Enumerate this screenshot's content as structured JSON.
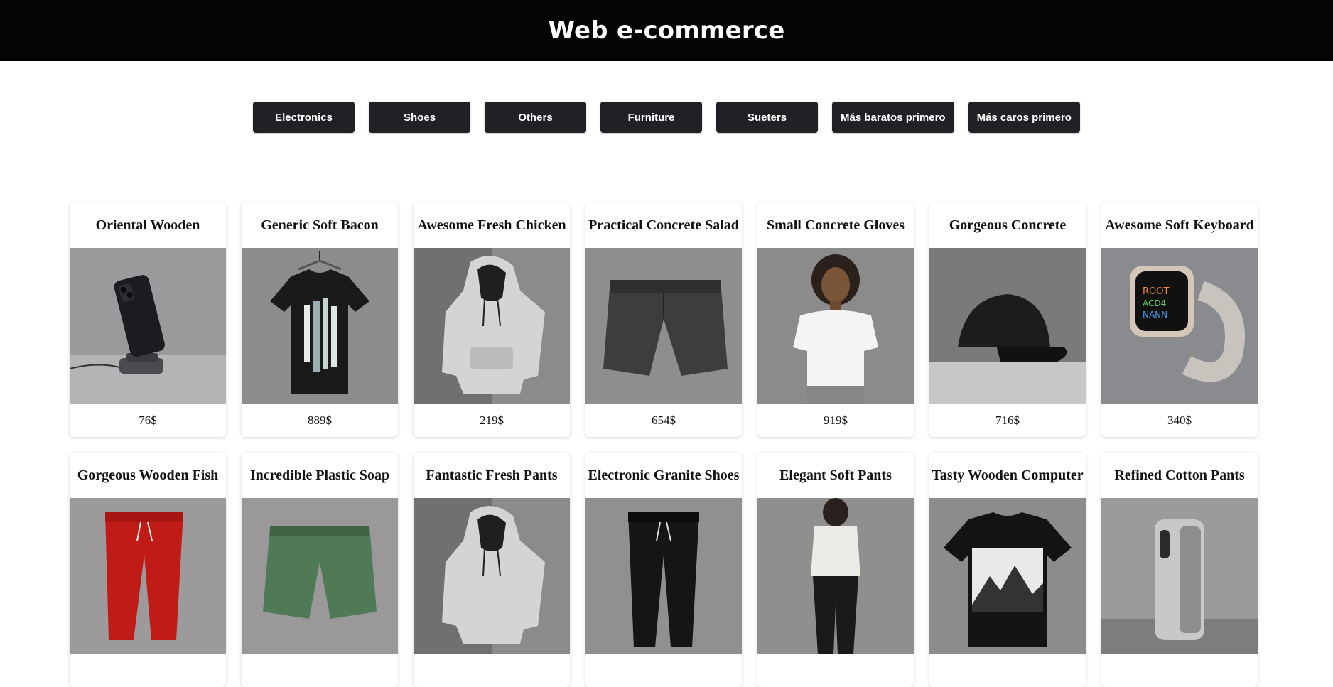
{
  "header": {
    "title": "Web e-commerce"
  },
  "filters": [
    "Electronics",
    "Shoes",
    "Others",
    "Furniture",
    "Sueters",
    "Más baratos primero",
    "Más caros primero"
  ],
  "products": [
    {
      "name": "Oriental Wooden",
      "price": "76$",
      "image": "phone-on-stand"
    },
    {
      "name": "Generic Soft Bacon",
      "price": "889$",
      "image": "black-tshirt-stripes"
    },
    {
      "name": "Awesome Fresh Chicken",
      "price": "219$",
      "image": "grey-hoodie"
    },
    {
      "name": "Practical Concrete Salad",
      "price": "654$",
      "image": "grey-shorts"
    },
    {
      "name": "Small Concrete Gloves",
      "price": "919$",
      "image": "woman-white-tee"
    },
    {
      "name": "Gorgeous Concrete",
      "price": "716$",
      "image": "black-cap"
    },
    {
      "name": "Awesome Soft Keyboard",
      "price": "340$",
      "image": "smartwatch"
    },
    {
      "name": "Gorgeous Wooden Fish",
      "price": "",
      "image": "red-joggers"
    },
    {
      "name": "Incredible Plastic Soap",
      "price": "",
      "image": "green-shorts"
    },
    {
      "name": "Fantastic Fresh Pants",
      "price": "",
      "image": "grey-hoodie"
    },
    {
      "name": "Electronic Granite Shoes",
      "price": "",
      "image": "black-joggers"
    },
    {
      "name": "Elegant Soft Pants",
      "price": "",
      "image": "woman-sweatpants"
    },
    {
      "name": "Tasty Wooden Computer",
      "price": "",
      "image": "mountain-tshirt"
    },
    {
      "name": "Refined Cotton Pants",
      "price": "",
      "image": "phone-case"
    }
  ],
  "colors": {
    "header_bg": "#030405",
    "button_bg": "#1f2125",
    "page_bg": "#ffffff"
  }
}
